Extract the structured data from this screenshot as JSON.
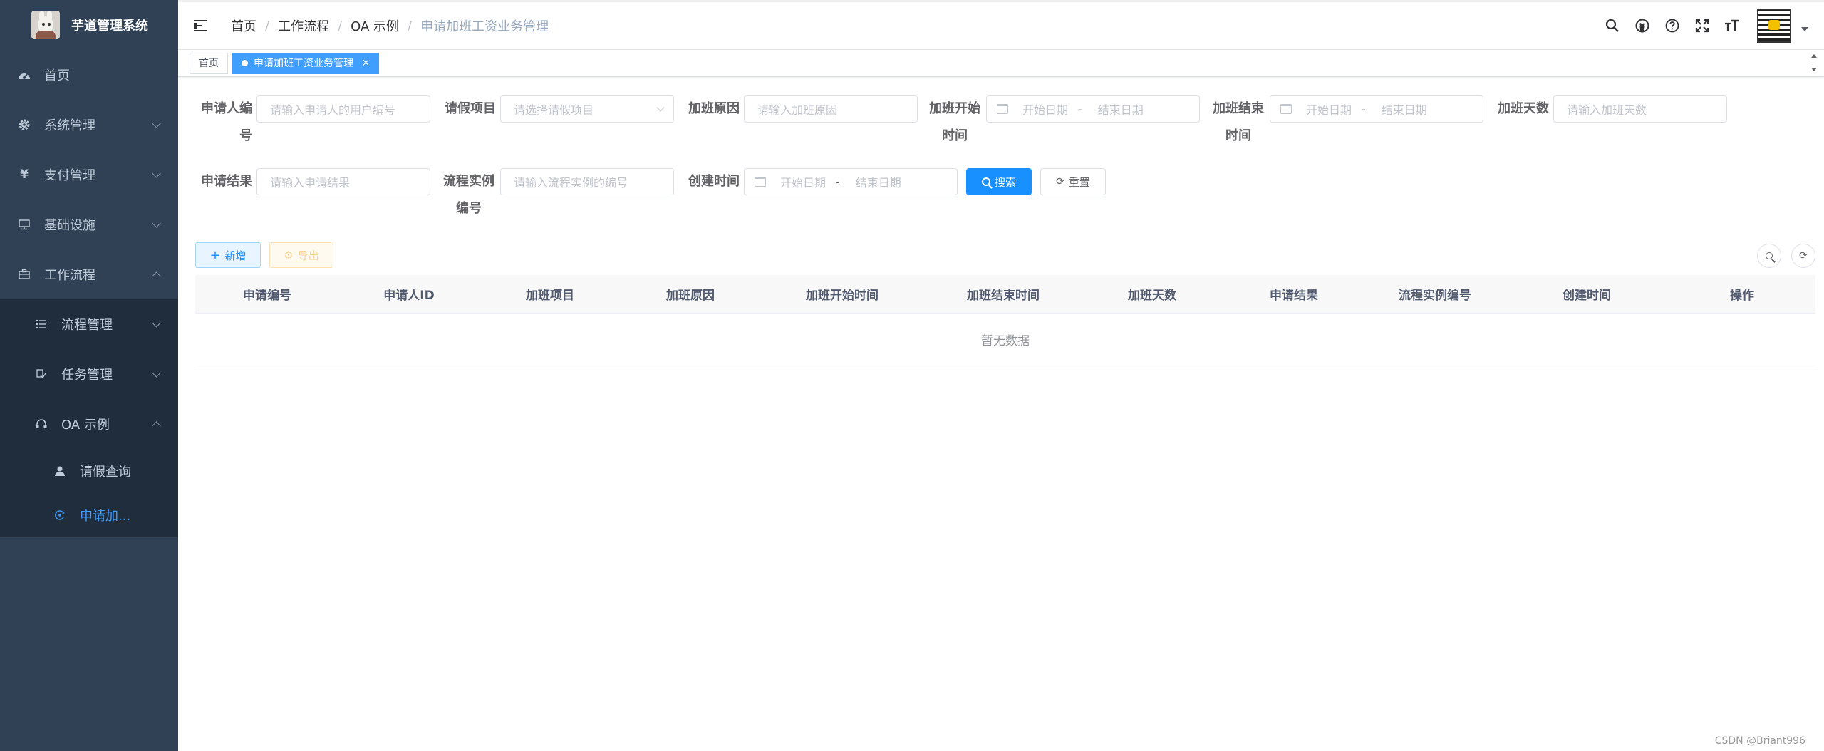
{
  "app": {
    "title": "芋道管理系统",
    "accent": "#409eff",
    "sidebar_bg": "#304156",
    "submenu_bg": "#1f2d3d"
  },
  "sidebar": {
    "items": [
      {
        "label": "首页",
        "icon": "dashboard-icon"
      },
      {
        "label": "系统管理",
        "icon": "gear-icon"
      },
      {
        "label": "支付管理",
        "icon": "yen-icon"
      },
      {
        "label": "基础设施",
        "icon": "monitor-icon"
      },
      {
        "label": "工作流程",
        "icon": "briefcase-icon"
      }
    ],
    "workflow_children": [
      {
        "label": "流程管理",
        "icon": "list-icon"
      },
      {
        "label": "任务管理",
        "icon": "task-icon"
      },
      {
        "label": "OA 示例",
        "icon": "headset-icon"
      }
    ],
    "oa_children": [
      {
        "label": "请假查询",
        "icon": "user-icon"
      },
      {
        "label": "申请加...",
        "icon": "refresh-user-icon"
      }
    ]
  },
  "navbar": {
    "breadcrumb": [
      "首页",
      "工作流程",
      "OA 示例",
      "申请加班工资业务管理"
    ],
    "separator": "/"
  },
  "tags": {
    "home": "首页",
    "active": "申请加班工资业务管理",
    "close": "×"
  },
  "search_form": {
    "applicant_label": "申请人编号",
    "applicant_placeholder": "请输入申请人的用户编号",
    "leave_item_label": "请假项目",
    "leave_item_placeholder": "请选择请假项目",
    "reason_label": "加班原因",
    "reason_placeholder": "请输入加班原因",
    "start_time_label": "加班开始时间",
    "end_time_label": "加班结束时间",
    "days_label": "加班天数",
    "days_placeholder": "请输入加班天数",
    "result_label": "申请结果",
    "result_placeholder": "请输入申请结果",
    "process_label": "流程实例编号",
    "process_placeholder": "请输入流程实例的编号",
    "create_time_label": "创建时间",
    "start_date_placeholder": "开始日期",
    "end_date_placeholder": "结束日期",
    "range_separator": "-",
    "search_button": "搜索",
    "reset_button": "重置"
  },
  "toolbar": {
    "add_label": "新增",
    "export_label": "导出"
  },
  "table": {
    "columns": [
      "申请编号",
      "申请人ID",
      "加班项目",
      "加班原因",
      "加班开始时间",
      "加班结束时间",
      "加班天数",
      "申请结果",
      "流程实例编号",
      "创建时间",
      "操作"
    ],
    "empty_text": "暂无数据"
  },
  "watermark": "CSDN @Briant996"
}
